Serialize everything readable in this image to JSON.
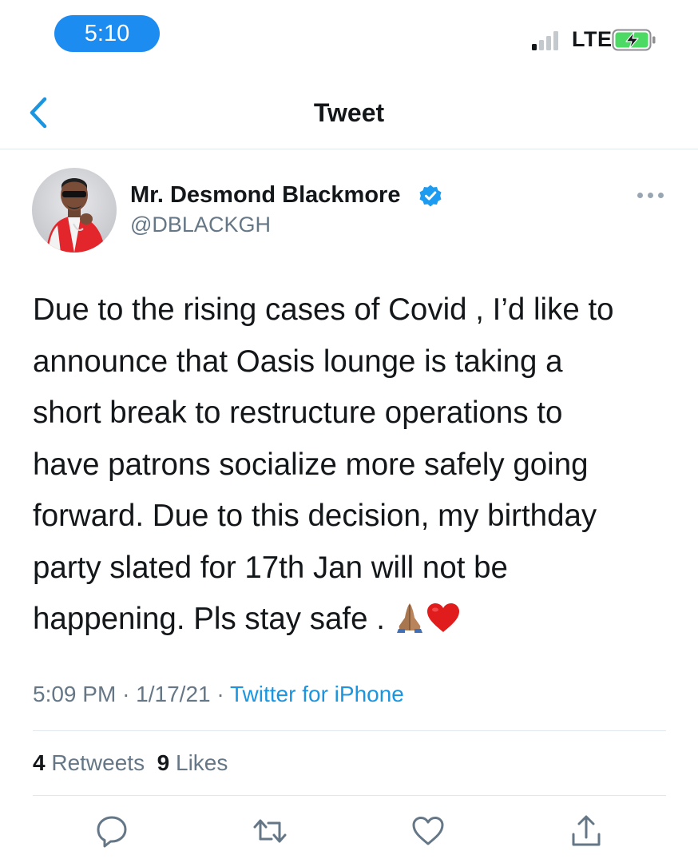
{
  "status_bar": {
    "time": "5:10",
    "network": "LTE",
    "icons": [
      "signal-icon",
      "battery-charging-icon"
    ]
  },
  "nav": {
    "title": "Tweet",
    "back_icon": "chevron-left-icon"
  },
  "tweet": {
    "author_name": "Mr. Desmond Blackmore",
    "author_handle": "@DBLACKGH",
    "verified": true,
    "text": "Due to the rising cases of Covid , I’d like to announce that Oasis lounge is taking a short break to restructure operations to have patrons socialize more safely going forward. Due to this decision, my birthday party slated for 17th Jan will not be happening. Pls stay safe . 🙏🏽❤️",
    "text_main": "Due to the rising cases of Covid , I’d like to\nannounce that Oasis lounge is taking a\nshort break to restructure operations to\nhave patrons socialize more safely going\nforward. Due to this decision, my birthday\nparty slated for 17th Jan will not be\nhappening. Pls stay safe . ",
    "time": "5:09 PM",
    "date": "1/17/21",
    "separator": "·",
    "source": "Twitter for iPhone",
    "retweets_count": "4",
    "retweets_label": "Retweets",
    "likes_count": "9",
    "likes_label": "Likes"
  },
  "actions": [
    {
      "name": "reply",
      "icon": "reply-icon"
    },
    {
      "name": "retweet",
      "icon": "retweet-icon"
    },
    {
      "name": "like",
      "icon": "heart-outline-icon"
    },
    {
      "name": "share",
      "icon": "share-icon"
    }
  ],
  "colors": {
    "accent": "#1d8cf0",
    "link": "#1b95e0",
    "secondary_text": "#657786",
    "divider": "#e1e8ed",
    "battery_green": "#4cd964"
  }
}
